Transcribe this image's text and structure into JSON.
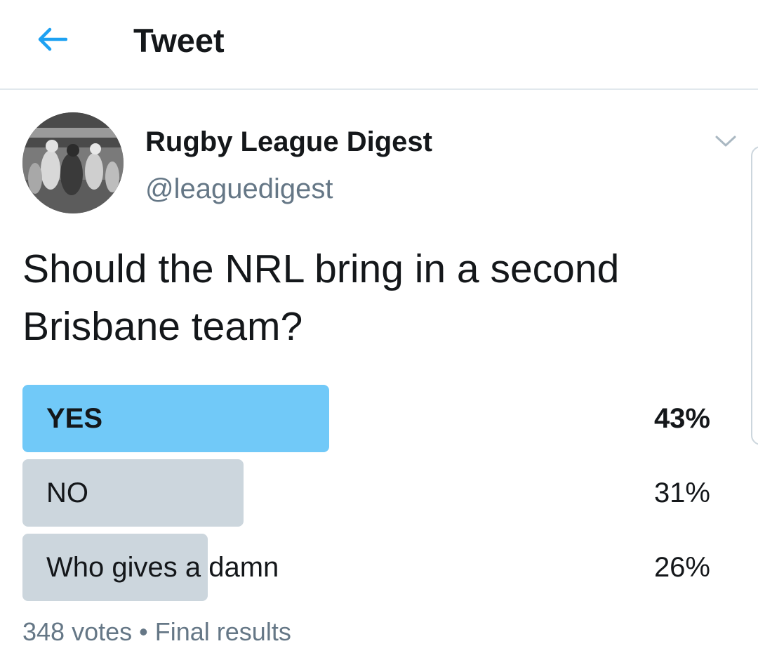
{
  "header": {
    "back_icon": "arrow-left-icon",
    "title": "Tweet",
    "accent_color": "#1da1f2"
  },
  "author": {
    "avatar": "black-and-white rugby match photo",
    "name": "Rugby League Digest",
    "handle": "@leaguedigest",
    "menu_icon": "chevron-down-icon"
  },
  "tweet": {
    "text": "Should the NRL bring in a second Brisbane team?"
  },
  "poll": {
    "options": [
      {
        "label": "YES",
        "percent": "43%",
        "value": 43,
        "winner": true,
        "bar_color": "#71c9f8"
      },
      {
        "label": "NO",
        "percent": "31%",
        "value": 31,
        "winner": false,
        "bar_color": "#ccd6dd"
      },
      {
        "label": "Who gives a damn",
        "percent": "26%",
        "value": 26,
        "winner": false,
        "bar_color": "#ccd6dd"
      }
    ],
    "votes": "348 votes",
    "separator": "•",
    "status": "Final results"
  }
}
